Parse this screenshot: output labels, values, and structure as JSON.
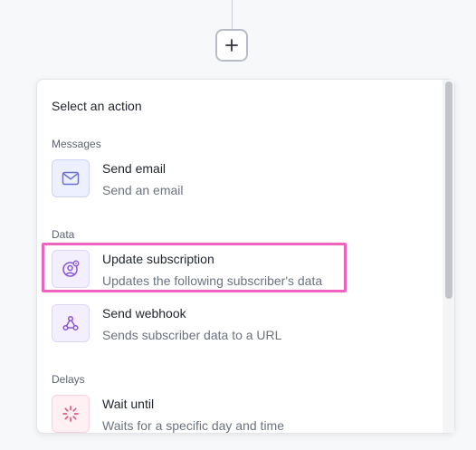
{
  "canvas": {
    "add_button_icon": "plus-icon"
  },
  "panel": {
    "title": "Select an action",
    "sections": [
      {
        "label": "Messages",
        "items": [
          {
            "title": "Send email",
            "description": "Send an email",
            "icon": "mail-icon",
            "icon_color": "#6a6fd0"
          }
        ]
      },
      {
        "label": "Data",
        "items": [
          {
            "title": "Update subscription",
            "description": "Updates the following subscriber's data",
            "icon": "user-gear-icon",
            "icon_color": "#8a55d6"
          },
          {
            "title": "Send webhook",
            "description": "Sends subscriber data to a URL",
            "icon": "webhook-icon",
            "icon_color": "#8a55d6"
          }
        ]
      },
      {
        "label": "Delays",
        "items": [
          {
            "title": "Wait until",
            "description": "Waits for a specific day and time",
            "icon": "loading-spinner-icon",
            "icon_color": "#e05a80"
          }
        ]
      }
    ]
  },
  "highlight": {
    "color": "#f062c0",
    "target": "Update subscription"
  }
}
